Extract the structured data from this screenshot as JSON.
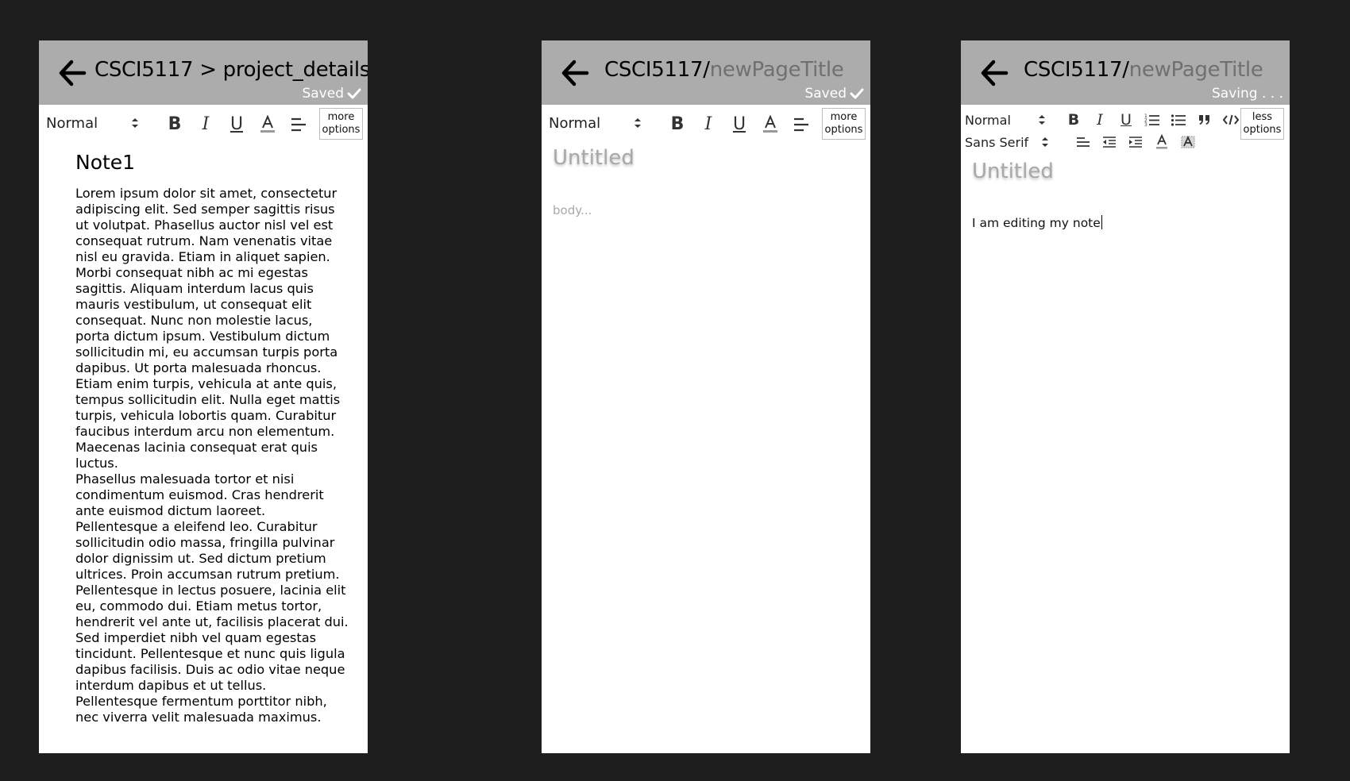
{
  "screens": [
    {
      "breadcrumb": "CSCI5117 > project_details",
      "status": "Saved",
      "toolbar": {
        "style_select": "Normal",
        "more_label_1": "more",
        "more_label_2": "options"
      },
      "note_title": "Note1",
      "body_paragraphs": [
        "Lorem ipsum dolor sit amet, consectetur adipiscing elit. Sed semper sagittis risus ut volutpat. Phasellus auctor nisl vel est consequat rutrum. Nam venenatis vitae nisl eu gravida. Etiam in aliquet sapien. Morbi consequat nibh ac mi egestas sagittis. Aliquam interdum lacus quis mauris vestibulum, ut consequat elit consequat. Nunc non molestie lacus, porta dictum ipsum. Vestibulum dictum sollicitudin mi, eu accumsan turpis porta dapibus. Ut porta malesuada rhoncus. Etiam enim turpis, vehicula at ante quis, tempus sollicitudin elit. Nulla eget mattis turpis, vehicula lobortis quam. Curabitur faucibus interdum arcu non elementum. Maecenas lacinia consequat erat quis luctus.",
        "Phasellus malesuada tortor et nisi condimentum euismod. Cras hendrerit ante euismod dictum laoreet. Pellentesque a eleifend leo. Curabitur sollicitudin odio massa, fringilla pulvinar dolor dignissim ut. Sed dictum pretium ultrices. Proin accumsan rutrum pretium. Pellentesque in lectus posuere, lacinia elit eu, commodo dui. Etiam metus tortor, hendrerit vel ante ut, facilisis placerat dui. Sed imperdiet nibh vel quam egestas tincidunt. Pellentesque et nunc quis ligula dapibus facilisis. Duis ac odio vitae neque interdum dapibus et ut tellus. Pellentesque fermentum porttitor nibh, nec viverra velit malesuada maximus."
      ]
    },
    {
      "breadcrumb_prefix": "CSCI5117/",
      "breadcrumb_page": "newPageTitle",
      "status": "Saved",
      "toolbar": {
        "style_select": "Normal",
        "more_label_1": "more",
        "more_label_2": "options"
      },
      "title_placeholder": "Untitled",
      "body_placeholder": "body..."
    },
    {
      "breadcrumb_prefix": "CSCI5117/",
      "breadcrumb_page": "newPageTitle",
      "status": "Saving . . .",
      "toolbar": {
        "style_select": "Normal",
        "font_select": "Sans Serif",
        "less_label_1": "less",
        "less_label_2": "options"
      },
      "title_placeholder": "Untitled",
      "body_text": "I am editing my note"
    }
  ],
  "icons": [
    "back-arrow-icon",
    "check-icon",
    "updown-icon",
    "bold-icon",
    "italic-icon",
    "underline-icon",
    "text-color-icon",
    "align-left-icon",
    "ordered-list-icon",
    "bullet-list-icon",
    "quote-icon",
    "code-icon",
    "outdent-icon",
    "indent-icon",
    "highlight-icon"
  ],
  "colors": {
    "background": "#1e1e1e",
    "header": "#acacac",
    "panel": "#ffffff",
    "muted_text": "#a8a8a8"
  }
}
